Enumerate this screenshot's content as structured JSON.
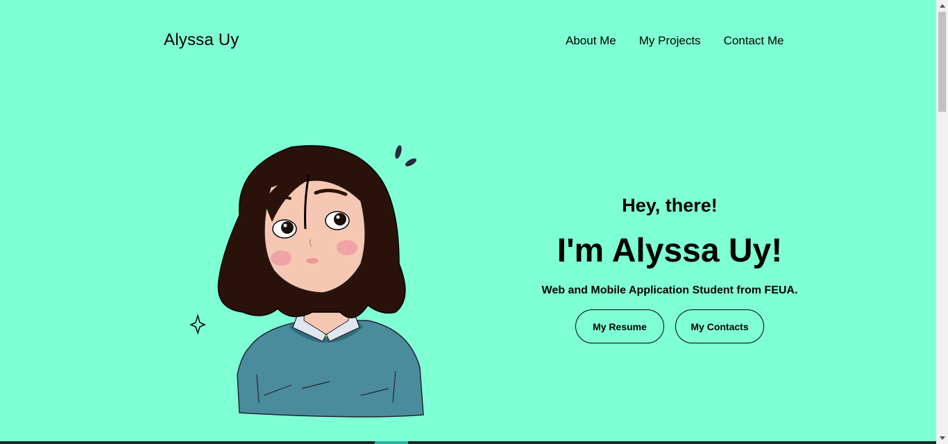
{
  "header": {
    "logo": "Alyssa Uy",
    "nav": [
      {
        "label": "About Me"
      },
      {
        "label": "My Projects"
      },
      {
        "label": "Contact Me"
      }
    ]
  },
  "hero": {
    "greeting": "Hey, there!",
    "name": "I'm Alyssa Uy!",
    "tagline": "Web and Mobile Application Student from FEUA.",
    "buttons": [
      {
        "label": "My Resume"
      },
      {
        "label": "My Contacts"
      }
    ]
  },
  "illustration": {
    "icon": "girl-avatar-illustration",
    "colors": {
      "hair": "#2a120a",
      "skin": "#f6c8b4",
      "blush": "#ef9aa4",
      "sweater": "#4b8c9c",
      "collar": "#dfe6ee"
    }
  },
  "theme": {
    "background": "#7fffd4"
  }
}
